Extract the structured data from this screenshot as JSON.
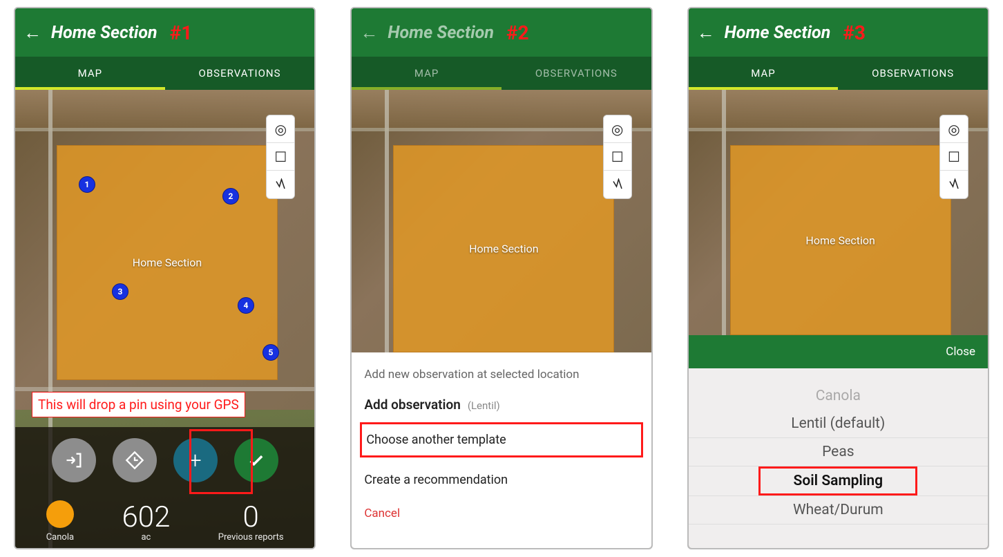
{
  "screens": {
    "s1": {
      "hash": "#1",
      "title": "Home Section",
      "tabs": {
        "map": "MAP",
        "obs": "OBSERVATIONS"
      },
      "field_label": "Home Section",
      "pins": [
        "1",
        "2",
        "3",
        "4",
        "5"
      ],
      "annotation": "This will drop a pin using your GPS",
      "stats": {
        "crop_label": "Canola",
        "area_value": "602",
        "area_unit": "ac",
        "reports_value": "0",
        "reports_label": "Previous reports"
      }
    },
    "s2": {
      "hash": "#2",
      "title": "Home Section",
      "tabs": {
        "map": "MAP",
        "obs": "OBSERVATIONS"
      },
      "field_label": "Home Section",
      "sheet": {
        "header": "Add new observation at selected location",
        "add_label": "Add observation",
        "add_crop": "(Lentil)",
        "choose_template": "Choose another template",
        "create_rec": "Create a recommendation",
        "cancel": "Cancel"
      }
    },
    "s3": {
      "hash": "#3",
      "title": "Home Section",
      "tabs": {
        "map": "MAP",
        "obs": "OBSERVATIONS"
      },
      "field_label": "Home Section",
      "close": "Close",
      "picker": {
        "opts": [
          "Canola",
          "Lentil (default)",
          "Peas",
          "Soil Sampling",
          "Wheat/Durum"
        ]
      }
    }
  }
}
